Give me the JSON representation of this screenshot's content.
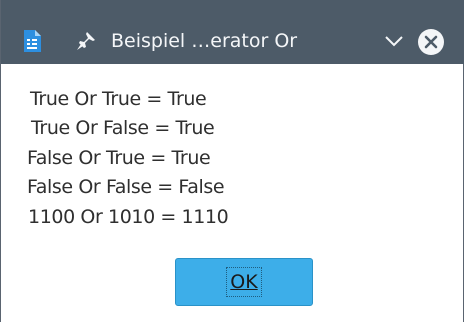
{
  "window": {
    "title": "Beispiel …erator Or",
    "icons": {
      "app": "document-app-icon",
      "pin": "pin-icon",
      "menu": "chevron-down-icon",
      "close": "close-circle-icon"
    },
    "colors": {
      "titlebar": "#4d5b68",
      "accent": "#3daee9"
    }
  },
  "message": {
    "lines": [
      "True Or True = True",
      "True Or False = True",
      "False Or True = True",
      "False Or False = False",
      "1100 Or 1010 = 1110"
    ]
  },
  "buttons": {
    "ok_label": "OK"
  }
}
